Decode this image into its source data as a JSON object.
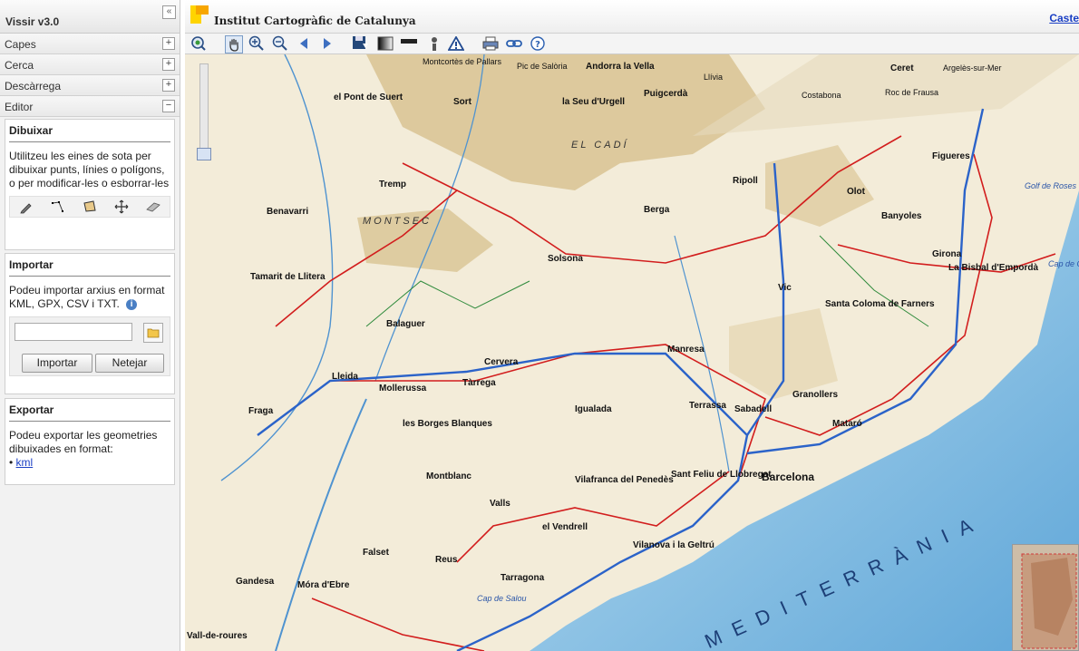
{
  "sidebar": {
    "title": "Vissir v3.0",
    "collapse_icon": "«",
    "sections": [
      {
        "label": "Capes",
        "toggle": "+"
      },
      {
        "label": "Cerca",
        "toggle": "+"
      },
      {
        "label": "Descàrrega",
        "toggle": "+"
      },
      {
        "label": "Editor",
        "toggle": "−"
      }
    ],
    "draw": {
      "title": "Dibuixar",
      "text": "Utilitzeu les eines de sota per dibuixar punts, línies o polígons, o per modificar-les o esborrar-les",
      "tools": [
        "pencil-icon",
        "polyline-icon",
        "polygon-icon",
        "move-icon",
        "eraser-icon"
      ]
    },
    "import": {
      "title": "Importar",
      "text": "Podeu importar arxius en format KML, GPX, CSV i TXT.",
      "info_icon": "i",
      "import_label": "Importar",
      "clear_label": "Netejar"
    },
    "export": {
      "title": "Exportar",
      "text": "Podeu exportar les geometries dibuixades en format:",
      "bullet": "•",
      "link": "kml"
    }
  },
  "header": {
    "org_name": "Institut Cartogràfic de Catalunya",
    "lang_link": "Caste",
    "logo_colors": [
      "#f7a600",
      "#ffd400"
    ]
  },
  "toolbar": {
    "tools": [
      "zoom-extent-icon",
      "pan-hand-icon",
      "zoom-in-icon",
      "zoom-out-icon",
      "back-icon",
      "forward-icon",
      "save-icon",
      "gradient-icon",
      "line-bar-icon",
      "info-icon",
      "warning-icon",
      "print-icon",
      "link-icon",
      "help-icon"
    ],
    "selected": "pan-hand-icon"
  },
  "map": {
    "places": [
      {
        "name": "Montcortès de Pallars",
        "cls": "pl"
      },
      {
        "name": "Pic de Salòria",
        "cls": "pl"
      },
      {
        "name": "Andorra la Vella",
        "cls": "pl big"
      },
      {
        "name": "Llívia",
        "cls": "pl"
      },
      {
        "name": "Ceret",
        "cls": "pl big"
      },
      {
        "name": "Argelès-sur-Mer",
        "cls": "pl"
      },
      {
        "name": "el Pont de Suert",
        "cls": "pl big"
      },
      {
        "name": "Sort",
        "cls": "pl big"
      },
      {
        "name": "la Seu d'Urgell",
        "cls": "pl big"
      },
      {
        "name": "Puigcerdà",
        "cls": "pl big"
      },
      {
        "name": "Costabona",
        "cls": "pl"
      },
      {
        "name": "Roc de Frausa",
        "cls": "pl"
      },
      {
        "name": "EL CADÍ",
        "cls": "pl reg"
      },
      {
        "name": "Ripoll",
        "cls": "pl big"
      },
      {
        "name": "Figueres",
        "cls": "pl big"
      },
      {
        "name": "Tremp",
        "cls": "pl big"
      },
      {
        "name": "Solsona",
        "cls": "pl big"
      },
      {
        "name": "Berga",
        "cls": "pl big"
      },
      {
        "name": "Olot",
        "cls": "pl big"
      },
      {
        "name": "Banyoles",
        "cls": "pl big"
      },
      {
        "name": "Girona",
        "cls": "pl big"
      },
      {
        "name": "Benavarri",
        "cls": "pl big"
      },
      {
        "name": "MONTSEC",
        "cls": "pl reg"
      },
      {
        "name": "Vic",
        "cls": "pl big"
      },
      {
        "name": "La Bisbal d'Empordà",
        "cls": "pl big"
      },
      {
        "name": "Tamarit de Llitera",
        "cls": "pl big"
      },
      {
        "name": "Balaguer",
        "cls": "pl big"
      },
      {
        "name": "Santa Coloma de Farners",
        "cls": "pl big"
      },
      {
        "name": "Manresa",
        "cls": "pl big"
      },
      {
        "name": "Cervera",
        "cls": "pl big"
      },
      {
        "name": "Lleida",
        "cls": "pl big"
      },
      {
        "name": "Mollerussa",
        "cls": "pl big"
      },
      {
        "name": "Tàrrega",
        "cls": "pl big"
      },
      {
        "name": "Granollers",
        "cls": "pl big"
      },
      {
        "name": "Terrassa",
        "cls": "pl big"
      },
      {
        "name": "Sabadell",
        "cls": "pl big"
      },
      {
        "name": "Igualada",
        "cls": "pl big"
      },
      {
        "name": "Mataró",
        "cls": "pl big"
      },
      {
        "name": "Fraga",
        "cls": "pl big"
      },
      {
        "name": "les Borges Blanques",
        "cls": "pl big"
      },
      {
        "name": "Barcelona",
        "cls": "pl xl"
      },
      {
        "name": "Montblanc",
        "cls": "pl big"
      },
      {
        "name": "Sant Feliu de Llobregat",
        "cls": "pl big"
      },
      {
        "name": "Vilafranca del Penedès",
        "cls": "pl big"
      },
      {
        "name": "Valls",
        "cls": "pl big"
      },
      {
        "name": "el Vendrell",
        "cls": "pl big"
      },
      {
        "name": "Vilanova i la Geltrú",
        "cls": "pl big"
      },
      {
        "name": "Falset",
        "cls": "pl big"
      },
      {
        "name": "Reus",
        "cls": "pl big"
      },
      {
        "name": "Tarragona",
        "cls": "pl big"
      },
      {
        "name": "Gandesa",
        "cls": "pl big"
      },
      {
        "name": "Móra d'Ebre",
        "cls": "pl big"
      },
      {
        "name": "Vall-de-roures",
        "cls": "pl big"
      },
      {
        "name": "Cap de Salou",
        "cls": "pl water"
      },
      {
        "name": "MEDITERRÀNIA",
        "cls": "pl sea"
      },
      {
        "name": "Golf de Roses",
        "cls": "pl water"
      },
      {
        "name": "Cap de Creus",
        "cls": "pl water"
      }
    ]
  }
}
